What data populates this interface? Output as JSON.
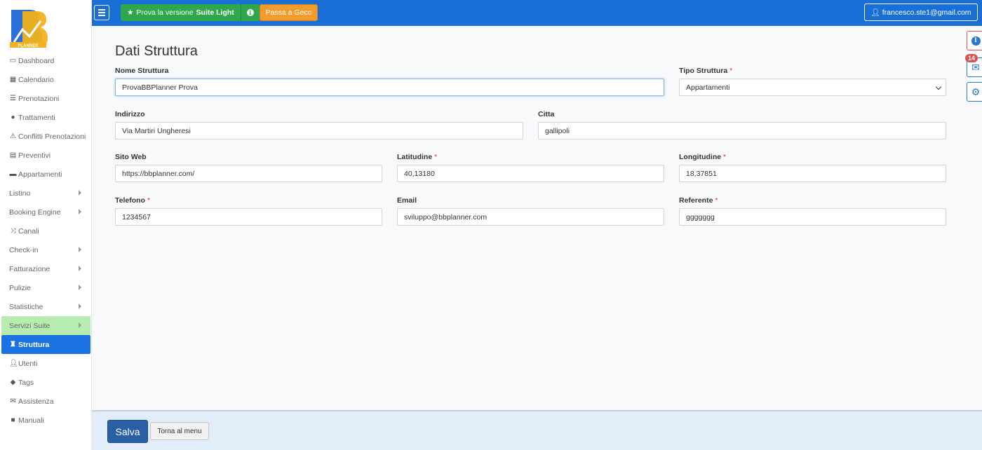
{
  "brand": {
    "logo_text": "PLANNER"
  },
  "topbar": {
    "suite_prefix": "Prova la versione",
    "suite_bold": "Suite Light",
    "geco_label": "Passa a Geco",
    "user_label": "francesco.ste1@gmail.com"
  },
  "sidebar": {
    "items": [
      {
        "label": "Dashboard",
        "icon": "monitor-icon"
      },
      {
        "label": "Calendario",
        "icon": "calendar-icon"
      },
      {
        "label": "Prenotazioni",
        "icon": "list-icon"
      },
      {
        "label": "Trattamenti",
        "icon": "apple-icon"
      },
      {
        "label": "Conflitti Prenotazioni",
        "icon": "warning-icon"
      },
      {
        "label": "Preventivi",
        "icon": "calculator-icon"
      },
      {
        "label": "Appartamenti",
        "icon": "bed-icon"
      },
      {
        "label": "Listino",
        "icon": ""
      },
      {
        "label": "Booking Engine",
        "icon": ""
      },
      {
        "label": "Canali",
        "icon": "shuffle-icon"
      },
      {
        "label": "Check-in",
        "icon": ""
      },
      {
        "label": "Fatturazione",
        "icon": ""
      },
      {
        "label": "Pulizie",
        "icon": ""
      },
      {
        "label": "Statistiche",
        "icon": ""
      },
      {
        "label": "Servizi Suite",
        "icon": ""
      },
      {
        "label": "Struttura",
        "icon": "castle-icon"
      },
      {
        "label": "Utenti",
        "icon": "user-icon"
      },
      {
        "label": "Tags",
        "icon": "tags-icon"
      },
      {
        "label": "Assistenza",
        "icon": "envelope-icon"
      },
      {
        "label": "Manuali",
        "icon": "book-icon"
      }
    ]
  },
  "page": {
    "title": "Dati Struttura"
  },
  "form": {
    "nome_struttura": {
      "label": "Nome Struttura",
      "value": "ProvaBBPlanner Prova"
    },
    "tipo_struttura": {
      "label": "Tipo Struttura",
      "value": "Appartamenti"
    },
    "indirizzo": {
      "label": "Indirizzo",
      "value": "Via Martiri Ungheresi"
    },
    "citta": {
      "label": "Citta",
      "value": "gallipoli"
    },
    "sito_web": {
      "label": "Sito Web",
      "value": "https://bbplanner.com/"
    },
    "latitudine": {
      "label": "Latitudine",
      "value": "40,13180"
    },
    "longitudine": {
      "label": "Longitudine",
      "value": "18,37851"
    },
    "telefono": {
      "label": "Telefono",
      "value": "1234567"
    },
    "email": {
      "label": "Email",
      "value": "sviluppo@bbplanner.com"
    },
    "referente": {
      "label": "Referente",
      "value": "ggggggg"
    },
    "required_mark": "*"
  },
  "floating": {
    "mail_badge": "14"
  },
  "footer": {
    "salva_label": "Salva",
    "torna_label": "Torna al menu"
  },
  "colors": {
    "topbar": "#1a6fd6",
    "active": "#1a73e0",
    "suite_green": "#2ea84a",
    "geco_orange": "#f39c2e",
    "save": "#2a5fa6"
  }
}
